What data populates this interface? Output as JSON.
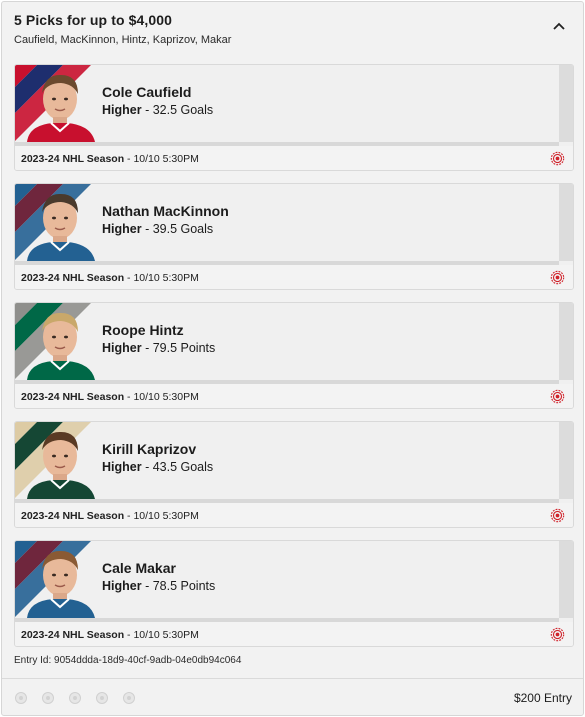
{
  "header": {
    "title": "5 Picks for up to $4,000",
    "subtitle": "Caufield, MacKinnon, Hintz, Kaprizov, Makar",
    "collapse_icon": "chevron-up-icon"
  },
  "picks": [
    {
      "name": "Cole Caufield",
      "direction": "Higher",
      "line": " - 32.5 Goals",
      "season": "2023-24 NHL Season",
      "time": " - 10/10 5:30PM",
      "stripe_colors": [
        "#c8102e",
        "#1e2e6e"
      ],
      "jersey_color": "#c8102e",
      "hair_color": "#6b4a2e",
      "status_icon": "live-target-icon"
    },
    {
      "name": "Nathan MacKinnon",
      "direction": "Higher",
      "line": " - 39.5 Goals",
      "season": "2023-24 NHL Season",
      "time": " - 10/10 5:30PM",
      "stripe_colors": [
        "#236192",
        "#6f263d"
      ],
      "jersey_color": "#236192",
      "hair_color": "#4a3a2c",
      "status_icon": "live-target-icon"
    },
    {
      "name": "Roope Hintz",
      "direction": "Higher",
      "line": " - 79.5 Points",
      "season": "2023-24 NHL Season",
      "time": " - 10/10 5:30PM",
      "stripe_colors": [
        "#8f8f8c",
        "#006847"
      ],
      "jersey_color": "#006847",
      "hair_color": "#c9a86a",
      "status_icon": "live-target-icon"
    },
    {
      "name": "Kirill Kaprizov",
      "direction": "Higher",
      "line": " - 43.5 Goals",
      "season": "2023-24 NHL Season",
      "time": " - 10/10 5:30PM",
      "stripe_colors": [
        "#ddcba4",
        "#154734"
      ],
      "jersey_color": "#154734",
      "hair_color": "#5a3a24",
      "status_icon": "live-target-icon"
    },
    {
      "name": "Cale Makar",
      "direction": "Higher",
      "line": " - 78.5 Points",
      "season": "2023-24 NHL Season",
      "time": " - 10/10 5:30PM",
      "stripe_colors": [
        "#236192",
        "#6f263d"
      ],
      "jersey_color": "#236192",
      "hair_color": "#8a5a34",
      "status_icon": "live-target-icon"
    }
  ],
  "entry_id": "Entry Id: 9054ddda-18d9-40cf-9adb-04e0db94c064",
  "entry_amount": "$200 Entry",
  "pick_dots": 5,
  "accent_color": "#d0232b"
}
